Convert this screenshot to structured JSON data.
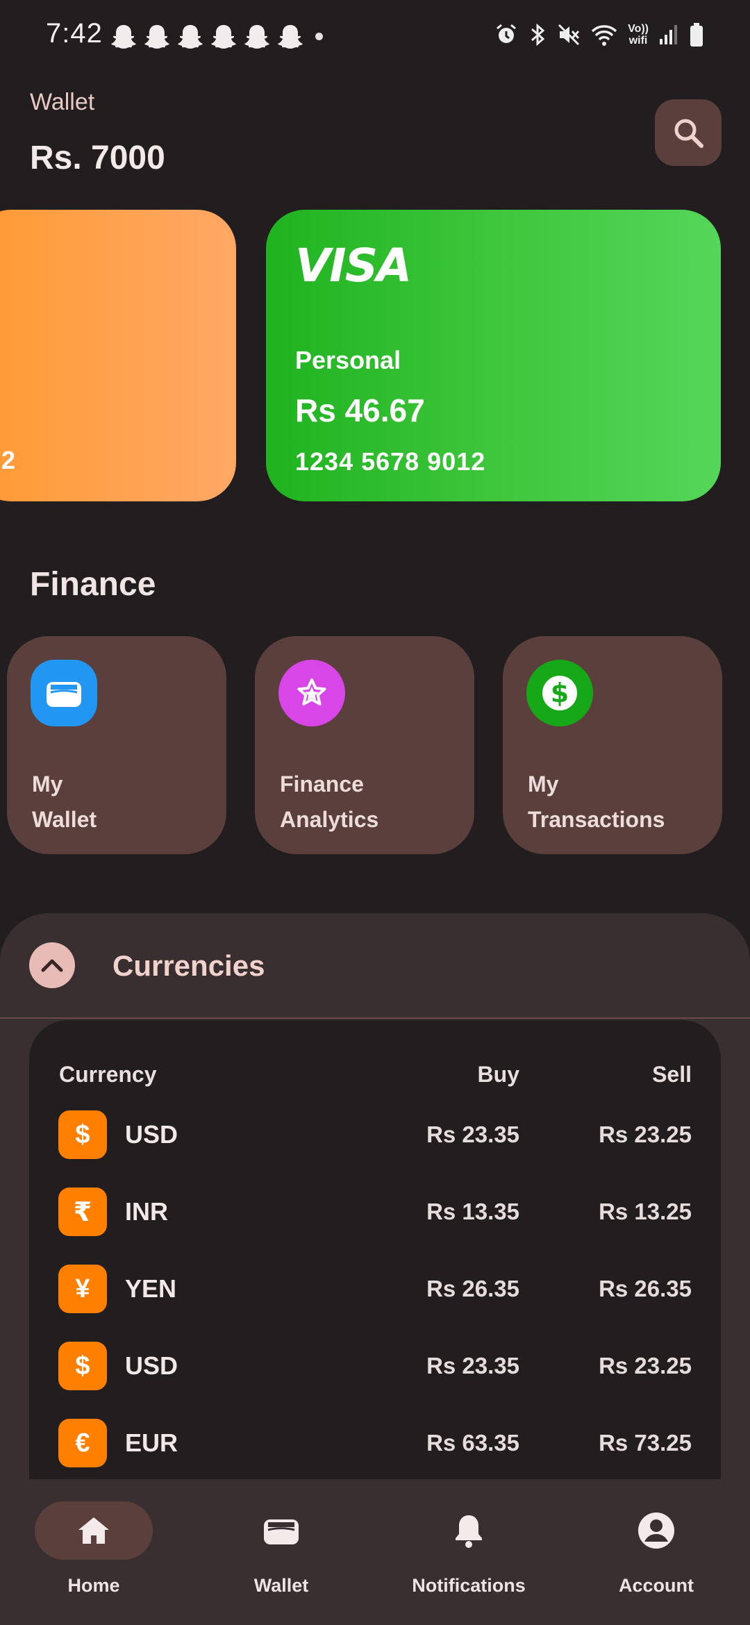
{
  "status_bar": {
    "time": "7:42",
    "network": [
      "Vo))",
      "wifi"
    ]
  },
  "header": {
    "label": "Wallet",
    "balance": "Rs. 7000"
  },
  "cards": [
    {
      "color": "#ff9a33",
      "number_partial": "2"
    },
    {
      "brand": "VISA",
      "name": "Personal",
      "balance": "Rs 46.67",
      "number": "1234 5678 9012",
      "color": "#3ec63c"
    }
  ],
  "finance": {
    "title": "Finance",
    "tiles": [
      {
        "line1": "My",
        "line2": "Wallet",
        "icon": "wallet-icon",
        "color": "#2196f3"
      },
      {
        "line1": "Finance",
        "line2": "Analytics",
        "icon": "star-icon",
        "color": "#d946e8"
      },
      {
        "line1": "My",
        "line2": "Transactions",
        "icon": "dollar-icon",
        "color": "#16a816"
      }
    ]
  },
  "currencies": {
    "title": "Currencies",
    "headers": {
      "currency": "Currency",
      "buy": "Buy",
      "sell": "Sell"
    },
    "rows": [
      {
        "symbol": "$",
        "code": "USD",
        "buy": "Rs 23.35",
        "sell": "Rs 23.25"
      },
      {
        "symbol": "₹",
        "code": "INR",
        "buy": "Rs 13.35",
        "sell": "Rs 13.25"
      },
      {
        "symbol": "¥",
        "code": "YEN",
        "buy": "Rs 26.35",
        "sell": "Rs 26.35"
      },
      {
        "symbol": "$",
        "code": "USD",
        "buy": "Rs 23.35",
        "sell": "Rs 23.25"
      },
      {
        "symbol": "€",
        "code": "EUR",
        "buy": "Rs 63.35",
        "sell": "Rs 73.25"
      }
    ]
  },
  "bottom_nav": {
    "items": [
      {
        "label": "Home",
        "icon": "home-icon",
        "active": true
      },
      {
        "label": "Wallet",
        "icon": "wallet-icon",
        "active": false
      },
      {
        "label": "Notifications",
        "icon": "bell-icon",
        "active": false
      },
      {
        "label": "Account",
        "icon": "account-icon",
        "active": false
      }
    ]
  },
  "colors": {
    "background": "#221d1e",
    "surface": "#392f30",
    "tile": "#5b3f3c",
    "currency_icon": "#ff8000"
  }
}
